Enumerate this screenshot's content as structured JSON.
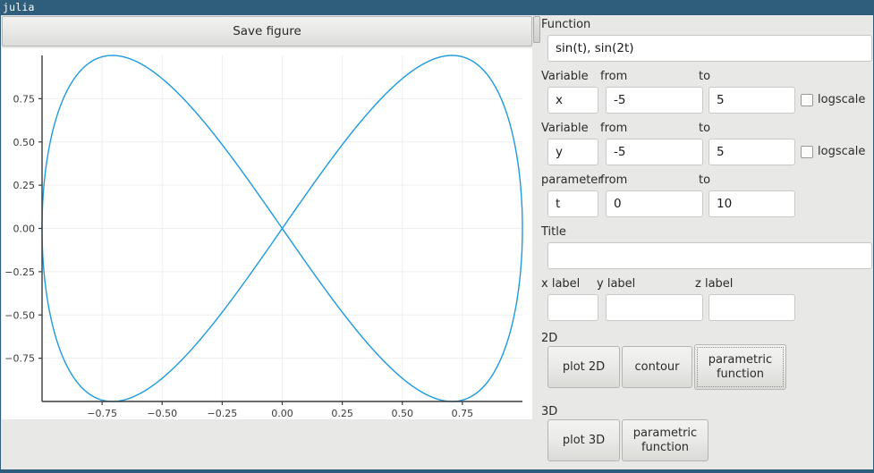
{
  "window": {
    "title": "julia"
  },
  "figure_panel": {
    "save_button_label": "Save figure"
  },
  "controls": {
    "function": {
      "label": "Function",
      "value": "sin(t), sin(2t)",
      "placeholder": ""
    },
    "var_rows": [
      {
        "label": "Variable",
        "from_label": "from",
        "to_label": "to",
        "name_value": "x",
        "from_value": "-5",
        "to_value": "5",
        "logscale_label": "logscale",
        "logscale_checked": false
      },
      {
        "label": "Variable",
        "from_label": "from",
        "to_label": "to",
        "name_value": "y",
        "from_value": "-5",
        "to_value": "5",
        "logscale_label": "logscale",
        "logscale_checked": false
      }
    ],
    "parameter_row": {
      "label": "parameter",
      "from_label": "from",
      "to_label": "to",
      "name_value": "t",
      "from_value": "0",
      "to_value": "10"
    },
    "title_field": {
      "label": "Title",
      "value": "",
      "placeholder": ""
    },
    "axis_labels": {
      "x": {
        "label": "x label",
        "value": ""
      },
      "y": {
        "label": "y label",
        "value": ""
      },
      "z": {
        "label": "z label",
        "value": ""
      }
    },
    "group_2d": {
      "label": "2D",
      "buttons": [
        {
          "label": "plot 2D",
          "focused": false
        },
        {
          "label": "contour",
          "focused": false
        },
        {
          "label": "parametric function",
          "focused": true
        }
      ]
    },
    "group_3d": {
      "label": "3D",
      "buttons": [
        {
          "label": "plot 3D",
          "focused": false
        },
        {
          "label": "parametric function",
          "focused": false
        }
      ]
    }
  },
  "colors": {
    "titlebar": "#2f5d7c",
    "panel": "#e8e8e6",
    "curve": "#1f9ae0",
    "grid": "#efefef",
    "axis": "#3a3a3a"
  },
  "chart_data": {
    "type": "line",
    "title": "",
    "xlabel": "",
    "ylabel": "",
    "description": "Parametric Lissajous curve x = sin(t), y = sin(2t) for t from 0 to 10",
    "parametric": {
      "x_expression": "sin(t)",
      "y_expression": "sin(2t)",
      "t_from": 0,
      "t_to": 10
    },
    "xlim": [
      -1.0,
      1.0
    ],
    "ylim": [
      -1.0,
      1.0
    ],
    "xticks": [
      "-0.75",
      "-0.50",
      "-0.25",
      "0.00",
      "0.25",
      "0.50",
      "0.75"
    ],
    "xtick_values": [
      -0.75,
      -0.5,
      -0.25,
      0.0,
      0.25,
      0.5,
      0.75
    ],
    "yticks": [
      "0.75",
      "0.50",
      "0.25",
      "0.00",
      "-0.25",
      "-0.50",
      "-0.75"
    ],
    "ytick_values": [
      0.75,
      0.5,
      0.25,
      0.0,
      -0.25,
      -0.5,
      -0.75
    ],
    "grid": true,
    "legend": false,
    "series": [
      {
        "name": "sin(t), sin(2t)",
        "color": "#1f9ae0",
        "linewidth": 1.4
      }
    ]
  }
}
